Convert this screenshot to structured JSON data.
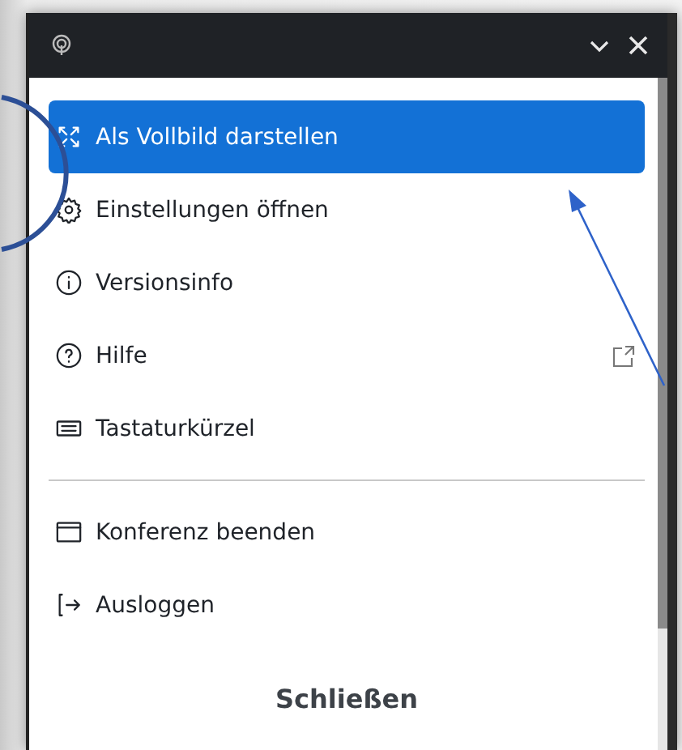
{
  "menu": {
    "sections": [
      {
        "items": [
          {
            "label": "Als Vollbild darstellen",
            "kind": "fullscreen",
            "selected": true,
            "external": false
          },
          {
            "label": "Einstellungen öffnen",
            "kind": "gear",
            "selected": false,
            "external": false
          },
          {
            "label": "Versionsinfo",
            "kind": "info",
            "selected": false,
            "external": false
          },
          {
            "label": "Hilfe",
            "kind": "help",
            "selected": false,
            "external": true
          },
          {
            "label": "Tastaturkürzel",
            "kind": "keyboard",
            "selected": false,
            "external": false
          }
        ]
      },
      {
        "items": [
          {
            "label": "Konferenz beenden",
            "kind": "window",
            "selected": false,
            "external": false
          },
          {
            "label": "Ausloggen",
            "kind": "logout",
            "selected": false,
            "external": false
          }
        ]
      }
    ]
  },
  "close_button": {
    "label": "Schließen"
  }
}
